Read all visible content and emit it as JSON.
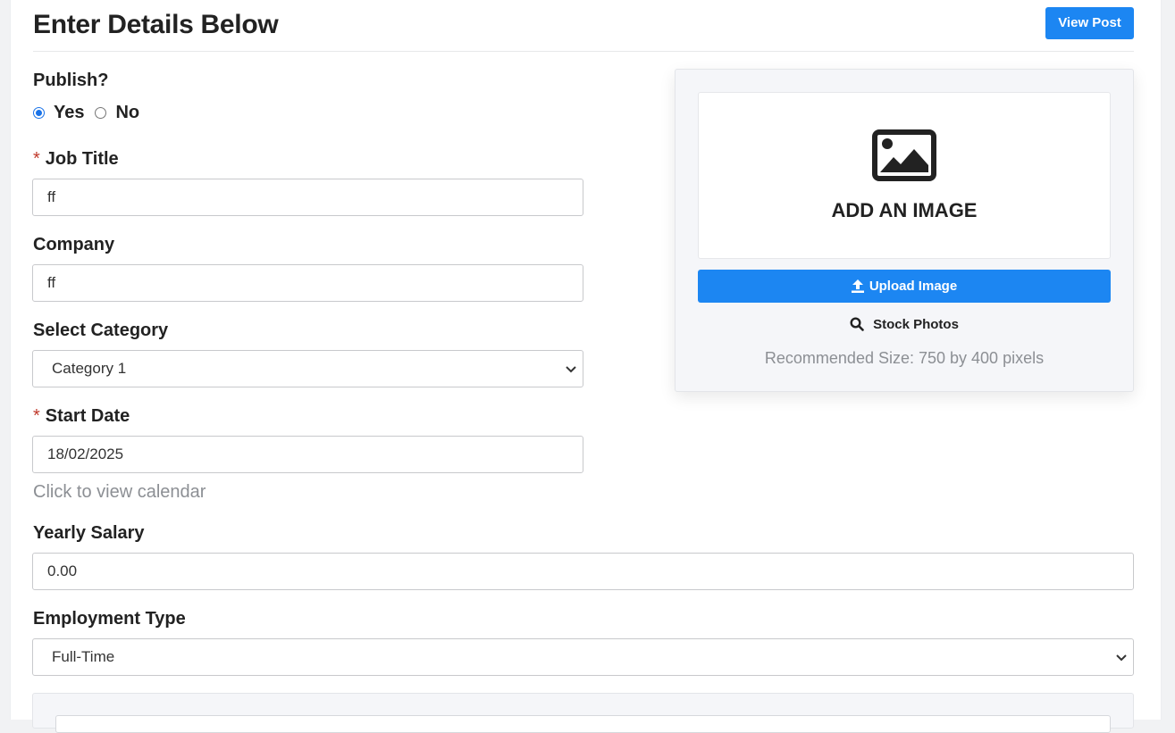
{
  "header": {
    "title": "Enter Details Below",
    "view_post_label": "View Post"
  },
  "publish": {
    "label": "Publish?",
    "options": [
      "Yes",
      "No"
    ],
    "selected": "Yes"
  },
  "job_title": {
    "required": "*",
    "label": "Job Title",
    "value": "ff"
  },
  "company": {
    "label": "Company",
    "value": "ff"
  },
  "category": {
    "label": "Select Category",
    "value": "Category 1"
  },
  "start_date": {
    "required": "*",
    "label": "Start Date",
    "value": "18/02/2025",
    "help": "Click to view calendar"
  },
  "salary": {
    "label": "Yearly Salary",
    "value": "0.00"
  },
  "employment_type": {
    "label": "Employment Type",
    "value": "Full-Time"
  },
  "image_panel": {
    "add_image_text": "ADD AN IMAGE",
    "upload_label": "Upload Image",
    "stock_label": "Stock Photos",
    "recommended": "Recommended Size: 750 by 400 pixels",
    "icons": {
      "image": "image-icon",
      "upload": "upload-icon",
      "search": "search-icon"
    }
  },
  "colors": {
    "primary": "#1c86f2",
    "required": "#c0392b",
    "muted": "#8c8f94"
  }
}
